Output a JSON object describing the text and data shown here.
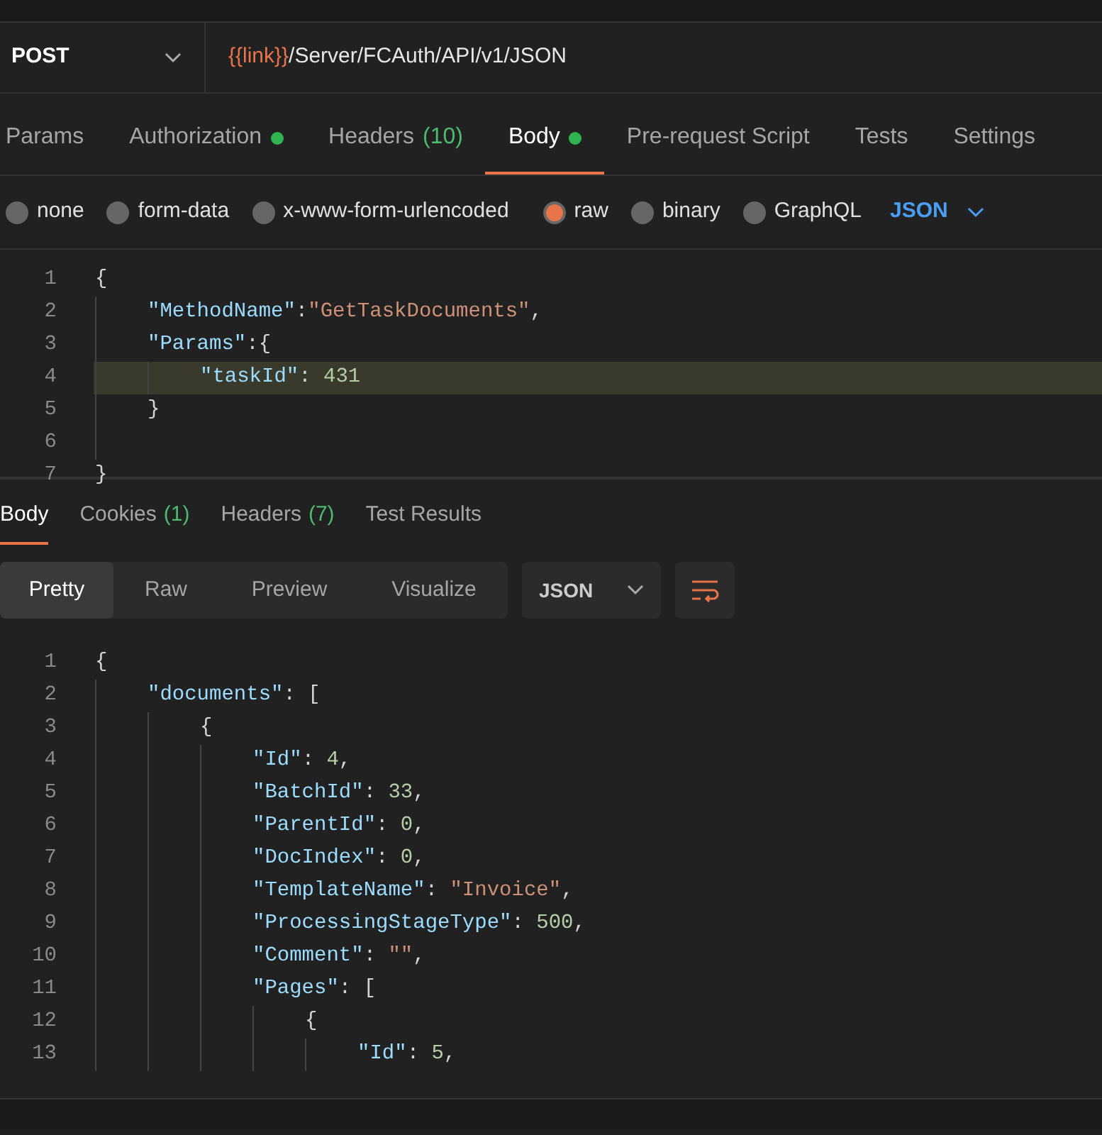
{
  "request": {
    "method": "POST",
    "url_variable": "{{link}}",
    "url_path": "/Server/FCAuth/API/v1/JSON"
  },
  "request_tabs": [
    {
      "label": "Params",
      "selected": false
    },
    {
      "label": "Authorization",
      "selected": false,
      "dot": true
    },
    {
      "label": "Headers",
      "count": "(10)",
      "selected": false
    },
    {
      "label": "Body",
      "selected": true,
      "dot": true
    },
    {
      "label": "Pre-request Script",
      "selected": false
    },
    {
      "label": "Tests",
      "selected": false
    },
    {
      "label": "Settings",
      "selected": false
    }
  ],
  "body_types": [
    {
      "label": "none",
      "selected": false
    },
    {
      "label": "form-data",
      "selected": false
    },
    {
      "label": "x-www-form-urlencoded",
      "selected": false
    },
    {
      "label": "raw",
      "selected": true
    },
    {
      "label": "binary",
      "selected": false
    },
    {
      "label": "GraphQL",
      "selected": false
    }
  ],
  "body_language": "JSON",
  "request_lines": [
    {
      "number": "1",
      "highlighted": false,
      "tokens": [
        {
          "kind": "punct",
          "text": "{"
        }
      ],
      "children": [
        {
          "number": "2",
          "highlighted": false,
          "tokens": [
            {
              "kind": "key",
              "text": "\"MethodName\""
            },
            {
              "kind": "punct",
              "text": ":"
            },
            {
              "kind": "string",
              "text": "\"GetTaskDocuments\""
            },
            {
              "kind": "punct",
              "text": ","
            }
          ]
        },
        {
          "number": "3",
          "highlighted": false,
          "tokens": [
            {
              "kind": "key",
              "text": "\"Params\""
            },
            {
              "kind": "punct",
              "text": ":{"
            }
          ],
          "children": [
            {
              "number": "4",
              "highlighted": true,
              "tokens": [
                {
                  "kind": "key",
                  "text": "\"taskId\""
                },
                {
                  "kind": "punct",
                  "text": ":"
                },
                {
                  "kind": "number",
                  "text": "431"
                }
              ]
            }
          ]
        },
        {
          "number": "5",
          "highlighted": false,
          "tokens": [
            {
              "kind": "punct",
              "text": "}"
            }
          ]
        },
        {
          "number": "6",
          "highlighted": false
        }
      ]
    },
    {
      "number": "7",
      "highlighted": false,
      "tokens": [
        {
          "kind": "punct",
          "text": "}"
        }
      ]
    }
  ],
  "response_tabs": [
    {
      "label": "Body",
      "selected": true
    },
    {
      "label": "Cookies",
      "count": "(1)",
      "selected": false
    },
    {
      "label": "Headers",
      "count": "(7)",
      "selected": false
    },
    {
      "label": "Test Results",
      "selected": false
    }
  ],
  "view_modes": [
    {
      "label": "Pretty",
      "selected": true
    },
    {
      "label": "Raw",
      "selected": false
    },
    {
      "label": "Preview",
      "selected": false
    },
    {
      "label": "Visualize",
      "selected": false
    }
  ],
  "response_language": "JSON",
  "response_lines": [
    {
      "number": "1",
      "tokens": [
        {
          "kind": "punct",
          "text": "{"
        }
      ],
      "children": [
        {
          "number": "2",
          "tokens": [
            {
              "kind": "key",
              "text": "\"documents\""
            },
            {
              "kind": "punct",
              "text": ":"
            },
            {
              "kind": "punct",
              "text": "["
            }
          ],
          "children": [
            {
              "number": "3",
              "tokens": [
                {
                  "kind": "punct",
                  "text": "{"
                }
              ],
              "children": [
                {
                  "number": "4",
                  "tokens": [
                    {
                      "kind": "key",
                      "text": "\"Id\""
                    },
                    {
                      "kind": "punct",
                      "text": ":"
                    },
                    {
                      "kind": "number",
                      "text": "4"
                    },
                    {
                      "kind": "punct",
                      "text": ","
                    }
                  ]
                },
                {
                  "number": "5",
                  "tokens": [
                    {
                      "kind": "key",
                      "text": "\"BatchId\""
                    },
                    {
                      "kind": "punct",
                      "text": ":"
                    },
                    {
                      "kind": "number",
                      "text": "33"
                    },
                    {
                      "kind": "punct",
                      "text": ","
                    }
                  ]
                },
                {
                  "number": "6",
                  "tokens": [
                    {
                      "kind": "key",
                      "text": "\"ParentId\""
                    },
                    {
                      "kind": "punct",
                      "text": ":"
                    },
                    {
                      "kind": "number",
                      "text": "0"
                    },
                    {
                      "kind": "punct",
                      "text": ","
                    }
                  ]
                },
                {
                  "number": "7",
                  "tokens": [
                    {
                      "kind": "key",
                      "text": "\"DocIndex\""
                    },
                    {
                      "kind": "punct",
                      "text": ":"
                    },
                    {
                      "kind": "number",
                      "text": "0"
                    },
                    {
                      "kind": "punct",
                      "text": ","
                    }
                  ]
                },
                {
                  "number": "8",
                  "tokens": [
                    {
                      "kind": "key",
                      "text": "\"TemplateName\""
                    },
                    {
                      "kind": "punct",
                      "text": ":"
                    },
                    {
                      "kind": "string",
                      "text": "\"Invoice\""
                    },
                    {
                      "kind": "punct",
                      "text": ","
                    }
                  ]
                },
                {
                  "number": "9",
                  "tokens": [
                    {
                      "kind": "key",
                      "text": "\"ProcessingStageType\""
                    },
                    {
                      "kind": "punct",
                      "text": ":"
                    },
                    {
                      "kind": "number",
                      "text": "500"
                    },
                    {
                      "kind": "punct",
                      "text": ","
                    }
                  ]
                },
                {
                  "number": "10",
                  "tokens": [
                    {
                      "kind": "key",
                      "text": "\"Comment\""
                    },
                    {
                      "kind": "punct",
                      "text": ":"
                    },
                    {
                      "kind": "string",
                      "text": "\"\""
                    },
                    {
                      "kind": "punct",
                      "text": ","
                    }
                  ]
                },
                {
                  "number": "11",
                  "tokens": [
                    {
                      "kind": "key",
                      "text": "\"Pages\""
                    },
                    {
                      "kind": "punct",
                      "text": ":"
                    },
                    {
                      "kind": "punct",
                      "text": "["
                    }
                  ],
                  "children": [
                    {
                      "number": "12",
                      "tokens": [
                        {
                          "kind": "punct",
                          "text": "{"
                        }
                      ],
                      "children": [
                        {
                          "number": "13",
                          "tokens": [
                            {
                              "kind": "key",
                              "text": "\"Id\""
                            },
                            {
                              "kind": "punct",
                              "text": ":"
                            },
                            {
                              "kind": "number",
                              "text": "5"
                            },
                            {
                              "kind": "punct",
                              "text": ","
                            }
                          ]
                        }
                      ]
                    }
                  ]
                }
              ]
            }
          ]
        }
      ]
    }
  ]
}
